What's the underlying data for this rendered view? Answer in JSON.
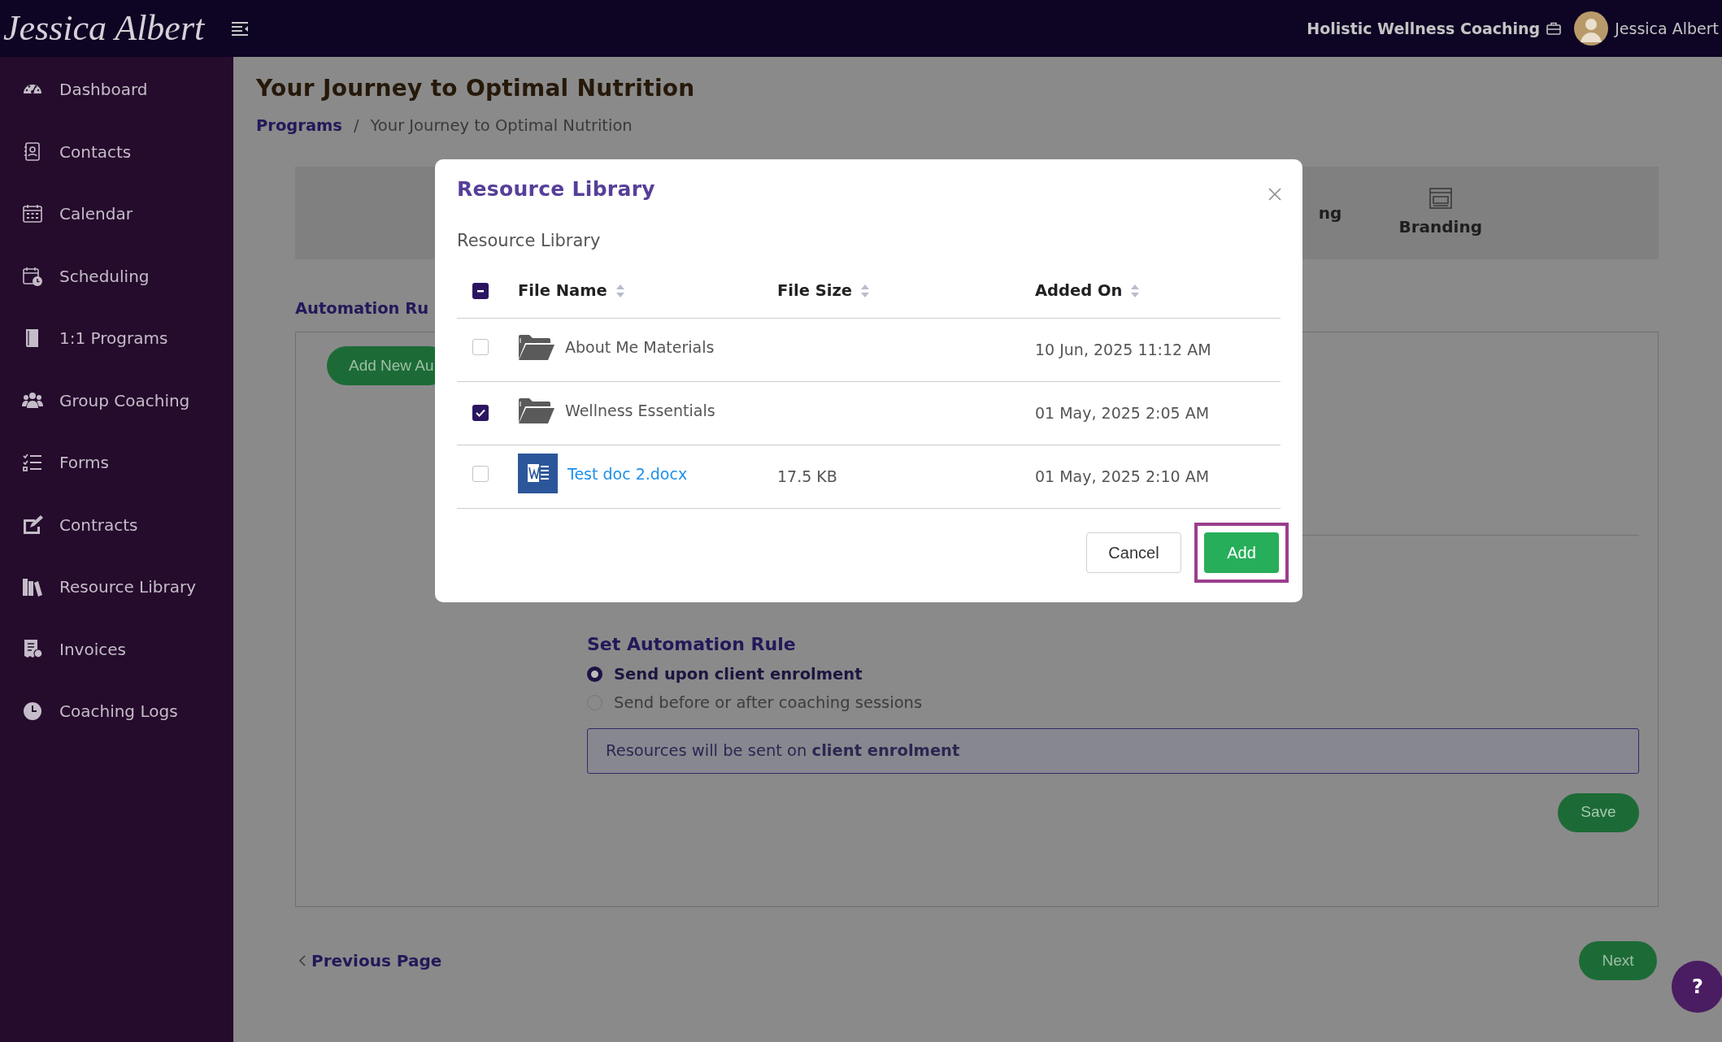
{
  "topbar": {
    "logo": "Jessica Albert",
    "business": "Holistic Wellness Coaching",
    "user": "Jessica Albert"
  },
  "sidebar": {
    "items": [
      {
        "label": "Dashboard",
        "kind": "gauge"
      },
      {
        "label": "Contacts",
        "kind": "contacts"
      },
      {
        "label": "Calendar",
        "kind": "calendar"
      },
      {
        "label": "Scheduling",
        "kind": "schedule"
      },
      {
        "label": "1:1 Programs",
        "kind": "book"
      },
      {
        "label": "Group Coaching",
        "kind": "people"
      },
      {
        "label": "Forms",
        "kind": "list"
      },
      {
        "label": "Contracts",
        "kind": "sign"
      },
      {
        "label": "Resource Library",
        "kind": "books"
      },
      {
        "label": "Invoices",
        "kind": "invoice"
      },
      {
        "label": "Coaching Logs",
        "kind": "clock"
      }
    ]
  },
  "page": {
    "title": "Your Journey to Optimal Nutrition",
    "breadcrumb_separator": "/",
    "breadcrumb": [
      {
        "label": "Programs",
        "kind": "link"
      },
      {
        "label": "Your Journey to Optimal Nutrition",
        "kind": "current"
      }
    ],
    "tabs": [
      {
        "label": "ng",
        "kind": "text"
      },
      {
        "label": "Branding",
        "kind": "branding"
      }
    ]
  },
  "automation": {
    "heading": "Automation Ru",
    "add_button": "Add New Au",
    "rule_heading": "Set Automation Rule",
    "options": [
      {
        "label": "Send upon client enrolment",
        "selected": true
      },
      {
        "label": "Send before or after coaching sessions",
        "selected": false
      }
    ],
    "info": "Resources will be sent on **client enrolment**",
    "save_button": "Save"
  },
  "footer": {
    "previous": "Previous Page",
    "next": "Next",
    "help": "?"
  },
  "modal": {
    "title": "Resource Library",
    "subtitle": "Resource Library",
    "select_all": {
      "indeterminate": true
    },
    "columns": [
      "File Name",
      "File Size",
      "Added On"
    ],
    "rows": [
      {
        "kind": "folder",
        "name": "About Me Materials",
        "added_on": "10 Jun, 2025 11:12 AM",
        "checked": false
      },
      {
        "kind": "folder",
        "name": "Wellness Essentials",
        "added_on": "01 May, 2025 2:05 AM",
        "checked": true
      },
      {
        "kind": "document",
        "name": "Test doc 2.docx",
        "size": "17.5 KB",
        "added_on": "01 May, 2025 2:10 AM",
        "checked": false
      }
    ],
    "buttons": [
      {
        "label": "Cancel",
        "kind": "secondary",
        "highlighted": false
      },
      {
        "label": "Add",
        "kind": "primary",
        "highlighted": true
      }
    ]
  }
}
